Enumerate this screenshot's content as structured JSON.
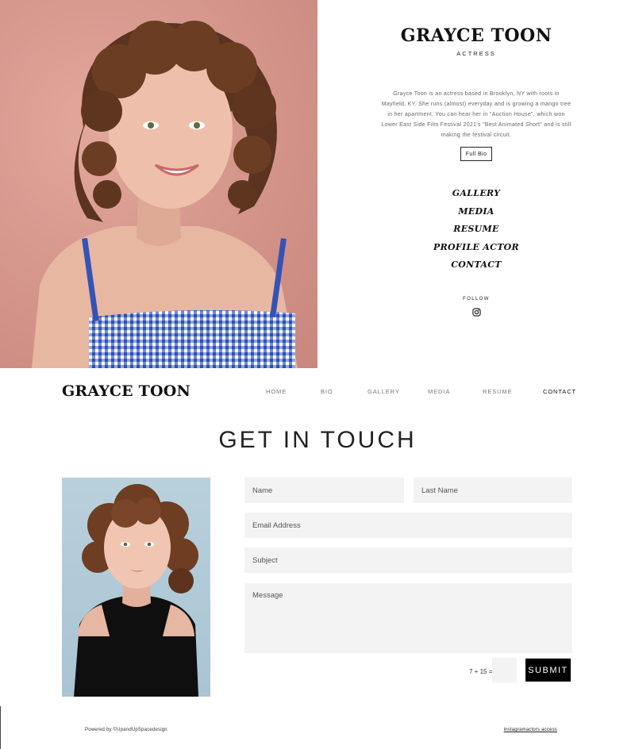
{
  "hero": {
    "name": "GRAYCE TOON",
    "role": "ACTRESS",
    "bio": "Grayce Toon is an actress based in Brooklyn, NY with roots in Mayfield, KY. She runs (almost) everyday and is growing a mango tree in her apartment. You can hear her in \"Auction House\", which won Lower East Side Film Festival 2021's \"Best Animated Short\" and is still making the festival circuit.",
    "full_bio_label": "Full Bio",
    "nav": [
      "GALLERY",
      "MEDIA",
      "RESUME",
      "PROFILE ACTOR",
      "CONTACT"
    ],
    "follow_label": "FOLLOW",
    "social_icon": "instagram-icon"
  },
  "header": {
    "logo": "GRAYCE TOON",
    "nav": [
      {
        "label": "HOME",
        "active": false
      },
      {
        "label": "BIO",
        "active": false
      },
      {
        "label": "GALLERY",
        "active": false
      },
      {
        "label": "MEDIA",
        "active": false
      },
      {
        "label": "RESUME",
        "active": false
      },
      {
        "label": "CONTACT",
        "active": true
      }
    ]
  },
  "contact": {
    "title": "GET IN TOUCH",
    "form": {
      "name_placeholder": "Name",
      "last_name_placeholder": "Last Name",
      "email_placeholder": "Email Address",
      "subject_placeholder": "Subject",
      "message_placeholder": "Message",
      "captcha_label": "7 + 15 =",
      "captcha_value": "",
      "submit_label": "SUBMIT"
    }
  },
  "footer": {
    "powered_by": "Powered by ©UpandUpSpacedesign",
    "link": "instagramactors access"
  },
  "colors": {
    "hero_background": "#d6978d",
    "field_background": "#f3f3f3",
    "submit_background": "#000000",
    "text": "#111111"
  }
}
